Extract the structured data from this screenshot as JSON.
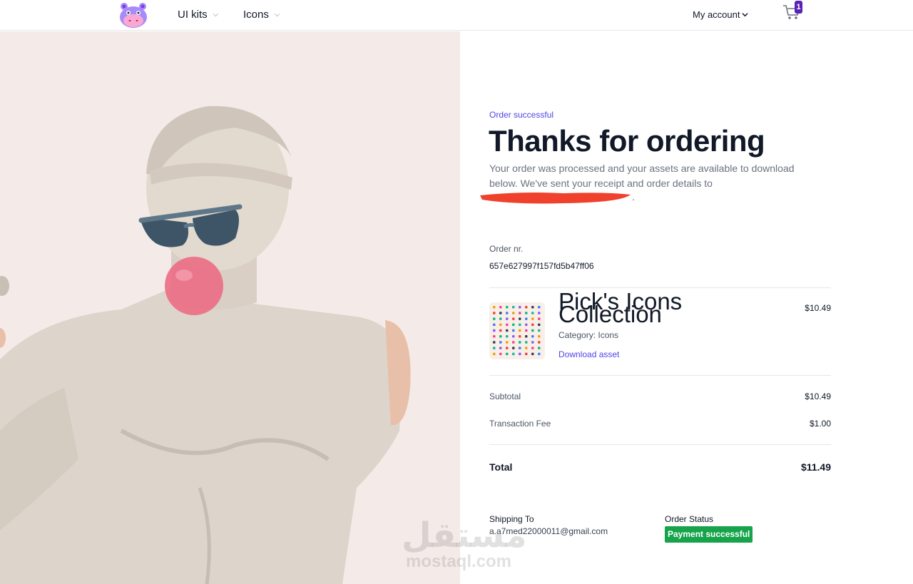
{
  "nav": {
    "items": [
      {
        "label": "UI kits"
      },
      {
        "label": "Icons"
      }
    ],
    "account_label": "My account",
    "cart_count": "1"
  },
  "order": {
    "eyebrow": "Order successful",
    "title": "Thanks for ordering",
    "description": "Your order was processed and your assets are available to download below. We've sent your receipt and order details to",
    "redacted_suffix": ".",
    "order_nr_label": "Order nr.",
    "order_nr": "657e627997f157fd5b47ff06"
  },
  "product": {
    "name": "Pick's Icons Collection",
    "category": "Category: Icons",
    "download_label": "Download asset",
    "price": "$10.49"
  },
  "summary": {
    "subtotal_label": "Subtotal",
    "subtotal": "$10.49",
    "fee_label": "Transaction Fee",
    "fee": "$1.00",
    "total_label": "Total",
    "total": "$11.49"
  },
  "shipping": {
    "label": "Shipping To",
    "email": "a.a7med22000011@gmail.com"
  },
  "status": {
    "label": "Order Status",
    "badge": "Payment successful",
    "badge_color": "#16a34a"
  },
  "watermark": {
    "arabic": "مستقل",
    "latin": "mostaql.com"
  },
  "colors": {
    "accent": "#4f46e5",
    "brand": "#5b21b6",
    "hero_bg": "#f4ebe9"
  }
}
